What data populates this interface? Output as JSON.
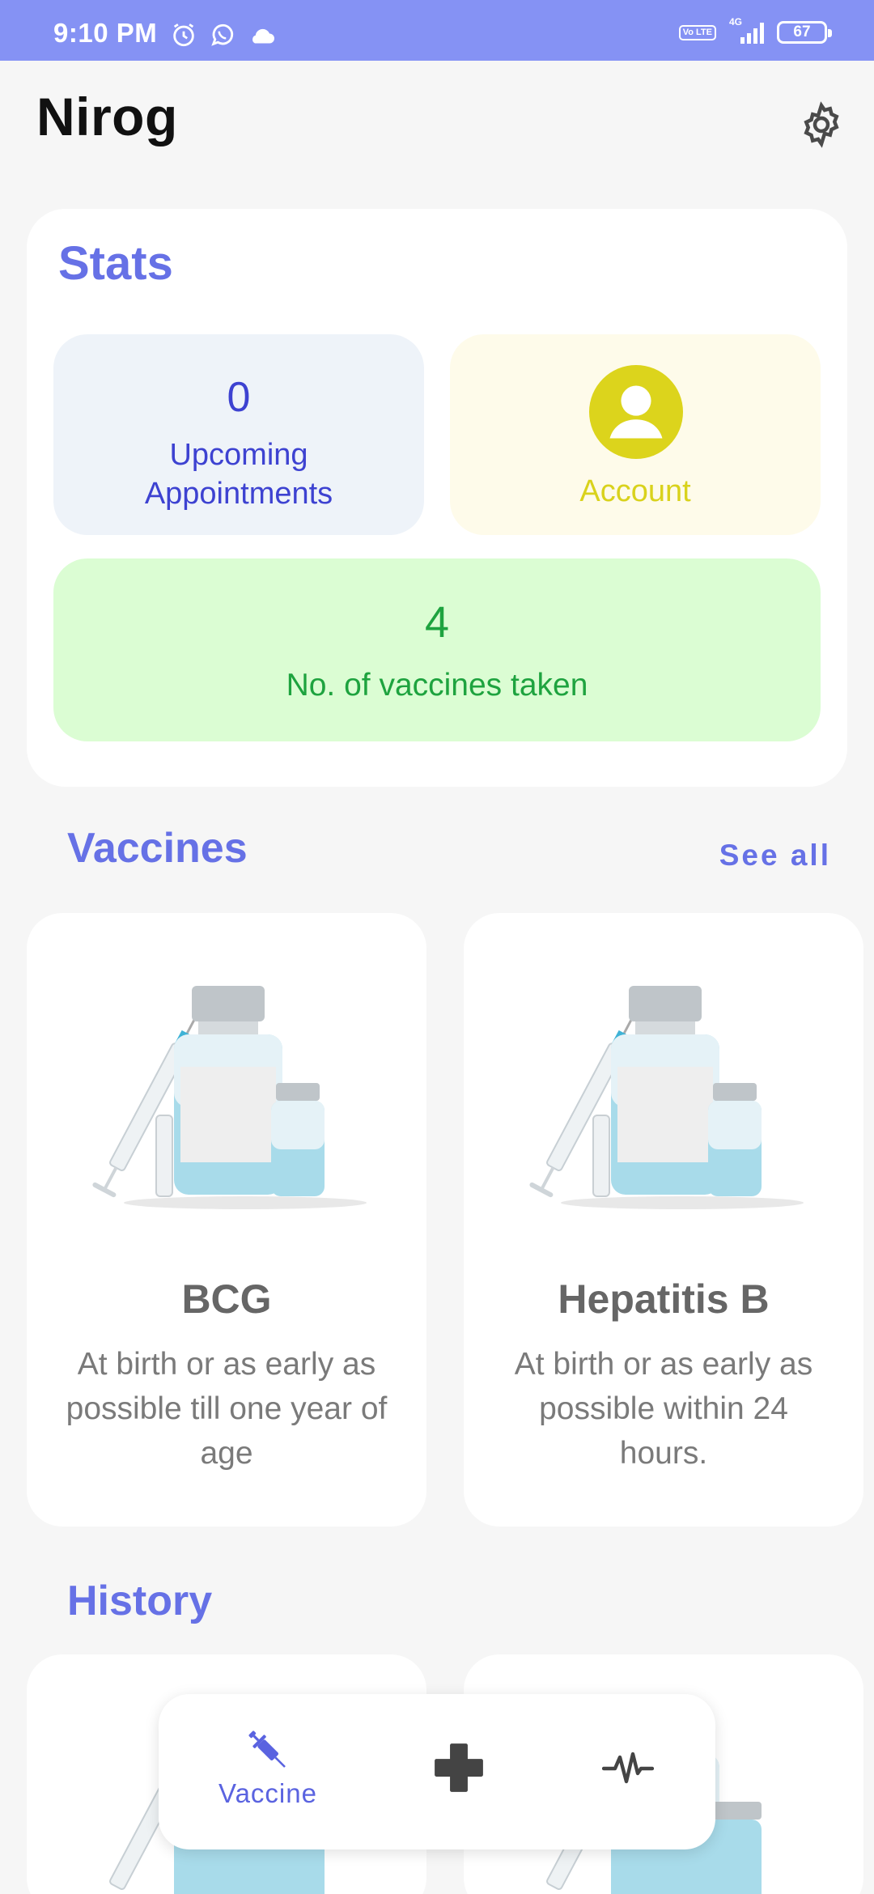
{
  "status_bar": {
    "time": "9:10 PM",
    "network": "4G",
    "volte": "Vo LTE",
    "battery": "67"
  },
  "header": {
    "title": "Nirog"
  },
  "stats": {
    "title": "Stats",
    "upcoming_count": "0",
    "upcoming_label_line1": "Upcoming",
    "upcoming_label_line2": "Appointments",
    "account_label": "Account",
    "vaccines_count": "4",
    "vaccines_label": "No. of vaccines taken"
  },
  "vaccines": {
    "title": "Vaccines",
    "see_all": "See all",
    "items": [
      {
        "name": "BCG",
        "description": "At birth or as early as possible till one year of age"
      },
      {
        "name": "Hepatitis B",
        "description": "At birth or as early as possible within 24 hours."
      }
    ]
  },
  "history": {
    "title": "History"
  },
  "bottom_nav": {
    "vaccine_label": "Vaccine"
  },
  "colors": {
    "accent": "#6671e6",
    "status_bar": "#8592f4",
    "account_yellow": "#d9d21c",
    "vax_green": "#1ea33f"
  }
}
